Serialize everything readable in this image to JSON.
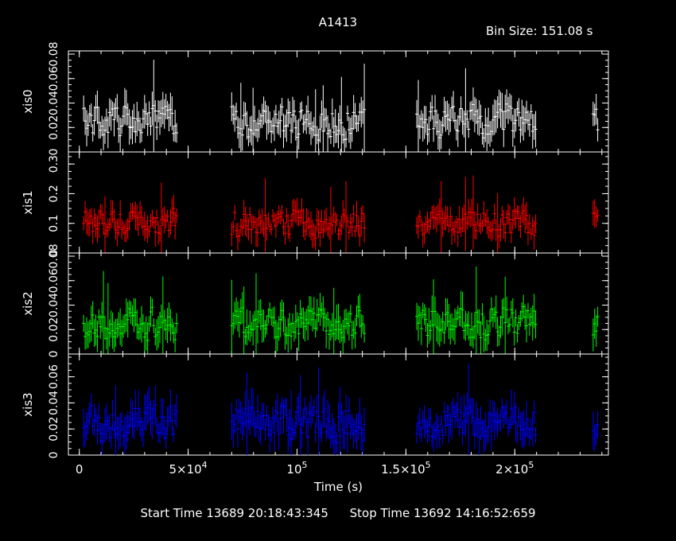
{
  "title": "A1413",
  "bin_size": "Bin Size: 151.08 s",
  "start_time": "Start Time 13689 20:18:43:345",
  "stop_time": "Stop Time 13692 14:16:52:659",
  "colors": {
    "background": "#000000",
    "axes": "#ffffff",
    "xis0": "#ffffff",
    "xis1": "#ff0000",
    "xis2": "#00ff00",
    "xis3": "#0000ff"
  },
  "chart_data": {
    "type": "line",
    "title": "A1413",
    "xlabel": "Time (s)",
    "xlim": [
      -5000,
      243000
    ],
    "x_ticks": [
      {
        "value": 0,
        "label": "0"
      },
      {
        "value": 50000,
        "label": "5×10^4"
      },
      {
        "value": 100000,
        "label": "10^5"
      },
      {
        "value": 150000,
        "label": "1.5×10^5"
      },
      {
        "value": 200000,
        "label": "2×10^5"
      }
    ],
    "observation_intervals": [
      [
        2000,
        45000
      ],
      [
        70000,
        131000
      ],
      [
        155000,
        210000
      ],
      [
        236000,
        238500
      ]
    ],
    "series": [
      {
        "name": "xis0",
        "color": "#ffffff",
        "ylim": [
          0,
          0.08
        ],
        "yticks": [
          0,
          0.02,
          0.04,
          0.06,
          0.08
        ],
        "ytick_labels": [
          "0",
          "0.02",
          "0.04",
          "0.06",
          "0.08"
        ],
        "typical_rate": 0.025,
        "spread": 0.015,
        "peak_rate": 0.08
      },
      {
        "name": "xis1",
        "color": "#ff0000",
        "ylim": [
          0,
          0.33
        ],
        "yticks": [
          0,
          0.1,
          0.2,
          0.3
        ],
        "ytick_labels": [
          "0",
          "0.1",
          "0.2",
          "0.3"
        ],
        "typical_rate": 0.1,
        "spread": 0.05,
        "peak_rate": 0.3
      },
      {
        "name": "xis2",
        "color": "#00ff00",
        "ylim": [
          0,
          0.08
        ],
        "yticks": [
          0,
          0.02,
          0.04,
          0.06,
          0.08
        ],
        "ytick_labels": [
          "0",
          "0.02",
          "0.04",
          "0.06",
          "0.08"
        ],
        "typical_rate": 0.025,
        "spread": 0.015,
        "peak_rate": 0.08
      },
      {
        "name": "xis3",
        "color": "#0000ff",
        "ylim": [
          0,
          0.075
        ],
        "yticks": [
          0,
          0.02,
          0.04,
          0.06
        ],
        "ytick_labels": [
          "0",
          "0.02",
          "0.04",
          "0.06"
        ],
        "typical_rate": 0.025,
        "spread": 0.015,
        "peak_rate": 0.075
      }
    ]
  }
}
